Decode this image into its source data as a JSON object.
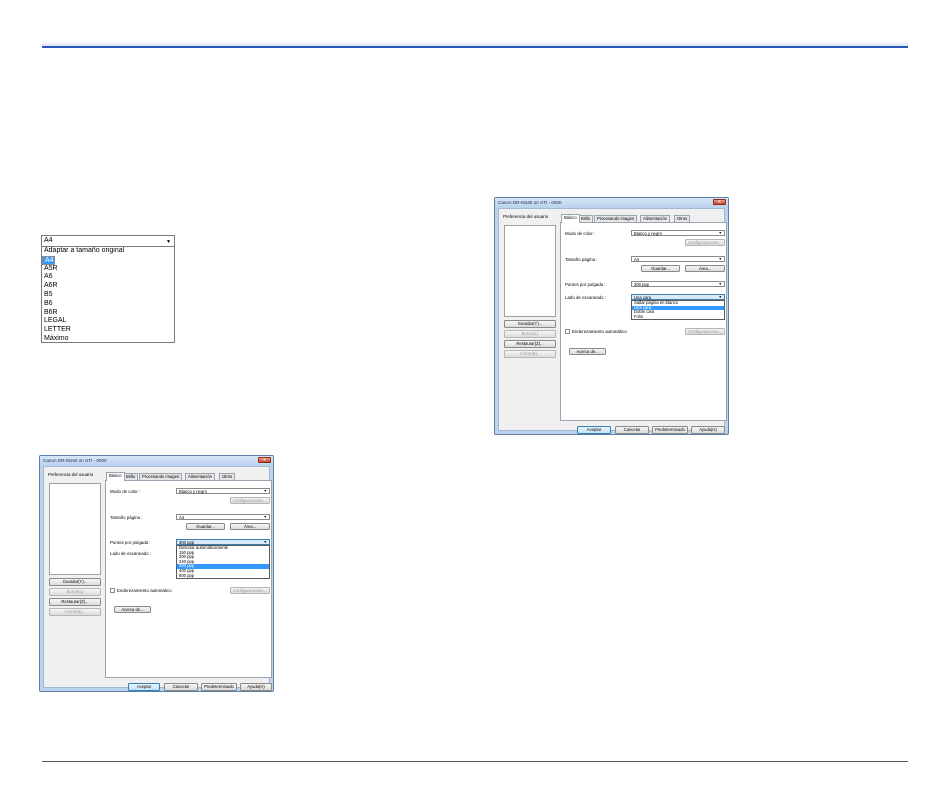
{
  "page_size_dropdown": {
    "selected": "A4",
    "options": [
      "Adaptar a tamaño original",
      "A4",
      "A5",
      "A5R",
      "A6",
      "A6R",
      "B5",
      "B6",
      "B6R",
      "LEGAL",
      "LETTER",
      "Máximo"
    ],
    "highlighted_index": 1
  },
  "dialog_resolution": {
    "title": "Canon DR-M160 on STI - 0000",
    "close": "x",
    "user_pref_label": "Preferencia del usuario",
    "buttons_left": {
      "save": "Guardar(Y)...",
      "delete": "Borrar(L)",
      "restore": "Restaurar(Z)...",
      "close": "Cerrar(B)..."
    },
    "tabs": [
      "Básico",
      "Brillo",
      "Procesando imagen",
      "Alimentación",
      "Otros"
    ],
    "color_mode_label": "Modo de color :",
    "color_mode_value": "Blanco y negro",
    "config_button": "Configuraciones...",
    "page_size_label": "Tamaño página :",
    "page_size_value": "A4",
    "save_button": "Guardar...",
    "area_button": "Área...",
    "dpi_label": "Puntos por pulgada :",
    "dpi_value": "300 ppp",
    "dpi_options": [
      "Detectar automáticamente",
      "150 ppp",
      "200 ppp",
      "240 ppp",
      "300 ppp",
      "400 ppp",
      "600 ppp"
    ],
    "dpi_highlighted_index": 4,
    "scan_side_label": "Lado de escaneado :",
    "deskew_label": "Enderezamiento automático",
    "deskew_config_button": "Configuraciones...",
    "about_button": "Acerca de...",
    "footer": {
      "ok": "Aceptar",
      "cancel": "Cancelar",
      "default": "Predeterminado",
      "help": "Ayuda(H)"
    }
  },
  "dialog_scanside": {
    "title": "Canon DR-M160 on STI - 0000",
    "close": "x",
    "user_pref_label": "Preferencia del usuario",
    "buttons_left": {
      "save": "Guardar(Y)...",
      "delete": "Borrar(L)",
      "restore": "Restaurar(Z)...",
      "close": "Cerrar(B)..."
    },
    "tabs": [
      "Básico",
      "Brillo",
      "Procesando imagen",
      "Alimentación",
      "Otros"
    ],
    "color_mode_label": "Modo de color :",
    "color_mode_value": "Blanco y negro",
    "config_button": "Configuraciones...",
    "page_size_label": "Tamaño página :",
    "page_size_value": "A4",
    "save_button": "Guardar...",
    "area_button": "Área...",
    "dpi_label": "Puntos por pulgada :",
    "dpi_value": "300 ppp",
    "scan_side_label": "Lado de escaneado :",
    "scan_side_value": "Una cara",
    "scan_side_options": [
      "Saltar página en blanco",
      "Una cara",
      "Doble cara",
      "Folio"
    ],
    "scan_side_highlighted_index": 1,
    "deskew_label": "Enderezamiento automático",
    "deskew_config_button": "Configuraciones...",
    "about_button": "Acerca de...",
    "footer": {
      "ok": "Aceptar",
      "cancel": "Cancelar",
      "default": "Predeterminado",
      "help": "Ayuda(H)"
    }
  }
}
